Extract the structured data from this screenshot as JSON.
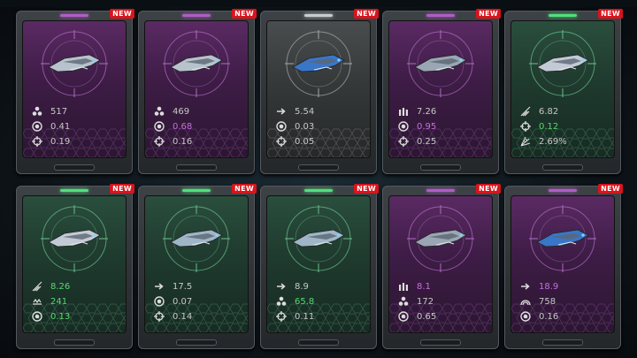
{
  "cards": [
    {
      "rarity": "purple",
      "badge": "NEW",
      "ship": "heavy-cruiser",
      "stats": [
        {
          "icon": "dots-icon",
          "value": "517",
          "tone": "normal"
        },
        {
          "icon": "target-ring-icon",
          "value": "0.41",
          "tone": "normal"
        },
        {
          "icon": "crosshair-icon",
          "value": "0.19",
          "tone": "normal"
        }
      ]
    },
    {
      "rarity": "purple",
      "badge": "NEW",
      "ship": "heavy-cruiser",
      "stats": [
        {
          "icon": "dots-icon",
          "value": "469",
          "tone": "normal"
        },
        {
          "icon": "target-ring-icon",
          "value": "0.68",
          "tone": "purple"
        },
        {
          "icon": "crosshair-icon",
          "value": "0.16",
          "tone": "normal"
        }
      ]
    },
    {
      "rarity": "gray",
      "badge": "NEW",
      "ship": "fighter",
      "stats": [
        {
          "icon": "arrow-icon",
          "value": "5.54",
          "tone": "normal"
        },
        {
          "icon": "target-ring-icon",
          "value": "0.03",
          "tone": "normal"
        },
        {
          "icon": "crosshair-icon",
          "value": "0.05",
          "tone": "normal"
        }
      ]
    },
    {
      "rarity": "purple",
      "badge": "NEW",
      "ship": "gunship",
      "stats": [
        {
          "icon": "ammo-icon",
          "value": "7.26",
          "tone": "normal"
        },
        {
          "icon": "target-ring-icon",
          "value": "0.95",
          "tone": "purple"
        },
        {
          "icon": "crosshair-icon",
          "value": "0.25",
          "tone": "normal"
        }
      ]
    },
    {
      "rarity": "green",
      "badge": "NEW",
      "ship": "interceptor",
      "stats": [
        {
          "icon": "wings-icon",
          "value": "6.82",
          "tone": "normal"
        },
        {
          "icon": "crosshair-icon",
          "value": "0.12",
          "tone": "green"
        },
        {
          "icon": "spread-icon",
          "value": "2.69%",
          "tone": "normal"
        }
      ]
    },
    {
      "rarity": "green",
      "badge": "NEW",
      "ship": "interceptor",
      "stats": [
        {
          "icon": "wings-icon",
          "value": "8.26",
          "tone": "green"
        },
        {
          "icon": "missile-icon",
          "value": "241",
          "tone": "green"
        },
        {
          "icon": "target-ring-icon",
          "value": "0.13",
          "tone": "green"
        }
      ]
    },
    {
      "rarity": "green",
      "badge": "NEW",
      "ship": "dart",
      "stats": [
        {
          "icon": "arrow-icon",
          "value": "17.5",
          "tone": "normal"
        },
        {
          "icon": "target-ring-icon",
          "value": "0.07",
          "tone": "normal"
        },
        {
          "icon": "crosshair-icon",
          "value": "0.14",
          "tone": "normal"
        }
      ]
    },
    {
      "rarity": "green",
      "badge": "NEW",
      "ship": "dart",
      "stats": [
        {
          "icon": "arrow-icon",
          "value": "8.9",
          "tone": "normal"
        },
        {
          "icon": "dots-icon",
          "value": "65.8",
          "tone": "green"
        },
        {
          "icon": "crosshair-icon",
          "value": "0.11",
          "tone": "normal"
        }
      ]
    },
    {
      "rarity": "purple",
      "badge": "NEW",
      "ship": "gunship",
      "stats": [
        {
          "icon": "ammo-icon",
          "value": "8.1",
          "tone": "purple"
        },
        {
          "icon": "dots-icon",
          "value": "172",
          "tone": "normal"
        },
        {
          "icon": "target-ring-icon",
          "value": "0.65",
          "tone": "normal"
        }
      ]
    },
    {
      "rarity": "purple",
      "badge": "NEW",
      "ship": "fighter",
      "stats": [
        {
          "icon": "arrow-icon",
          "value": "18.9",
          "tone": "purple"
        },
        {
          "icon": "arc-icon",
          "value": "758",
          "tone": "normal"
        },
        {
          "icon": "target-ring-icon",
          "value": "0.16",
          "tone": "normal"
        }
      ]
    }
  ],
  "colors": {
    "purple": "#c76ee0",
    "green": "#58d86f",
    "new_badge": "#d8141c"
  }
}
